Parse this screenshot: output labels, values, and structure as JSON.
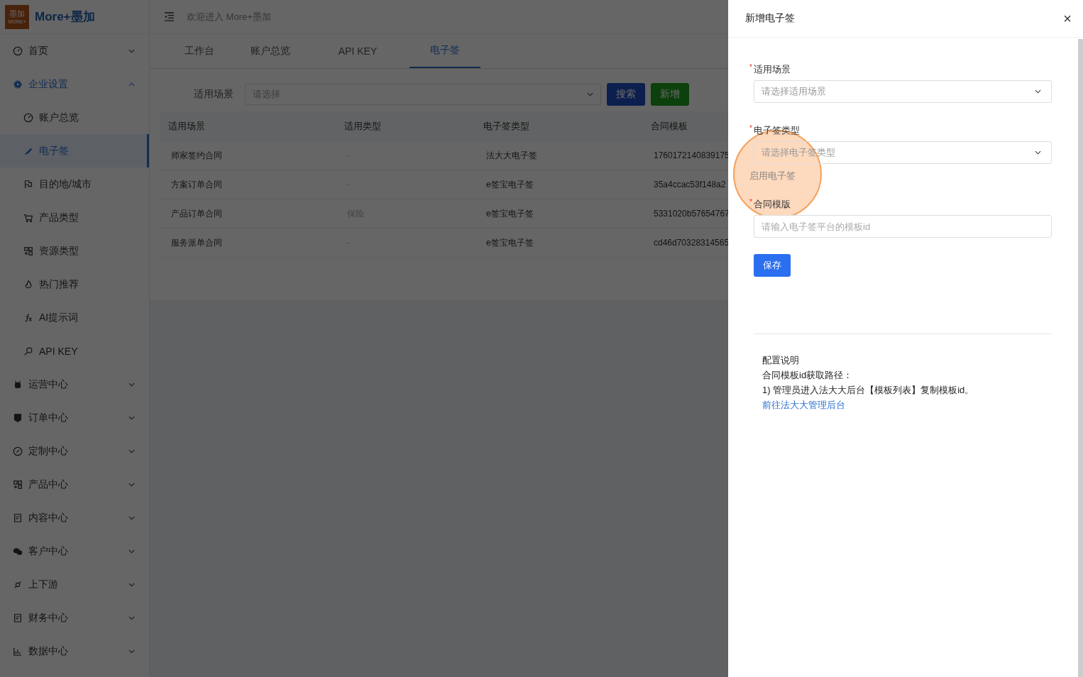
{
  "logo": {
    "badge": "墨加",
    "badge_sub": "MORE+",
    "name": "More+墨加"
  },
  "sidebar": {
    "items": [
      {
        "label": "首页",
        "expanded": false,
        "selected": false
      },
      {
        "label": "企业设置",
        "expanded": true,
        "selected": true,
        "children": [
          {
            "label": "账户总览",
            "selected": false
          },
          {
            "label": "电子签",
            "selected": true
          },
          {
            "label": "目的地/城市",
            "selected": false
          },
          {
            "label": "产品类型",
            "selected": false
          },
          {
            "label": "资源类型",
            "selected": false
          },
          {
            "label": "热门推荐",
            "selected": false
          },
          {
            "label": "AI提示词",
            "selected": false
          },
          {
            "label": "API KEY",
            "selected": false
          }
        ]
      },
      {
        "label": "运营中心",
        "expanded": false,
        "selected": false
      },
      {
        "label": "订单中心",
        "expanded": false,
        "selected": false
      },
      {
        "label": "定制中心",
        "expanded": false,
        "selected": false
      },
      {
        "label": "产品中心",
        "expanded": false,
        "selected": false
      },
      {
        "label": "内容中心",
        "expanded": false,
        "selected": false
      },
      {
        "label": "客户中心",
        "expanded": false,
        "selected": false
      },
      {
        "label": "上下游",
        "expanded": false,
        "selected": false
      },
      {
        "label": "财务中心",
        "expanded": false,
        "selected": false
      },
      {
        "label": "数据中心",
        "expanded": false,
        "selected": false
      }
    ]
  },
  "topbar": {
    "welcome": "欢迎进入 More+墨加"
  },
  "tabs": [
    {
      "label": "工作台",
      "selected": false
    },
    {
      "label": "账户总览",
      "selected": false
    },
    {
      "label": "API KEY",
      "selected": false
    },
    {
      "label": "电子签",
      "selected": true
    }
  ],
  "filter": {
    "label": "适用场景",
    "placeholder": "请选择",
    "buttons": [
      {
        "label": "搜索",
        "kind": "primary"
      },
      {
        "label": "新增",
        "kind": "success"
      }
    ]
  },
  "table": {
    "columns": [
      "适用场景",
      "适用类型",
      "电子签类型",
      "合同模板"
    ],
    "rows": [
      [
        "师家签约合同",
        "-",
        "法大大电子签",
        "1760172140839175"
      ],
      [
        "方案订单合同",
        "-",
        "e签宝电子签",
        "35a4ccac53f148a2"
      ],
      [
        "产品订单合同",
        "保险",
        "e签宝电子签",
        "5331020b57654767"
      ],
      [
        "服务派单合同",
        "-",
        "e签宝电子签",
        "cd46d70328314565"
      ]
    ]
  },
  "drawer": {
    "title": "新增电子签",
    "close": "×",
    "required_mark": "*",
    "fields": [
      {
        "kind": "select",
        "label": "适用场景",
        "required": true,
        "placeholder": "请选择适用场景"
      },
      {
        "kind": "select",
        "label": "电子签类型",
        "required": true,
        "placeholder": "请选择电子签类型"
      },
      {
        "kind": "label",
        "label": "启用电子签",
        "required": false
      },
      {
        "kind": "input",
        "label": "合同模版",
        "required": true,
        "placeholder": "请输入电子签平台的模板id"
      }
    ],
    "save": "保存",
    "notes": {
      "heading": "配置说明",
      "lines": [
        "合同模板id获取路径：",
        "1) 管理员进入法大大后台【模板列表】复制模板id。"
      ],
      "link": "前往法大大管理后台"
    }
  }
}
